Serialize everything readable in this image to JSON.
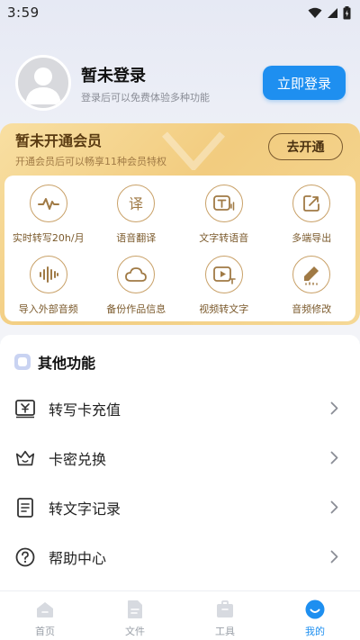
{
  "status_bar": {
    "time": "3:59"
  },
  "profile": {
    "name": "暂未登录",
    "subtitle": "登录后可以免费体验多种功能",
    "login_label": "立即登录"
  },
  "vip": {
    "title": "暂未开通会员",
    "subtitle": "开通会员后可以畅享11种会员特权",
    "open_label": "去开通",
    "features": [
      {
        "label": "实时转写20h/月",
        "icon": "waveform-icon"
      },
      {
        "label": "语音翻译",
        "icon": "translate-icon"
      },
      {
        "label": "文字转语音",
        "icon": "text-to-speech-icon"
      },
      {
        "label": "多端导出",
        "icon": "export-icon"
      },
      {
        "label": "导入外部音频",
        "icon": "audio-import-icon"
      },
      {
        "label": "备份作品信息",
        "icon": "cloud-backup-icon"
      },
      {
        "label": "视频转文字",
        "icon": "video-to-text-icon"
      },
      {
        "label": "音频修改",
        "icon": "audio-edit-icon"
      }
    ]
  },
  "other": {
    "title": "其他功能",
    "items": [
      {
        "label": "转写卡充值",
        "icon": "recharge-card-icon"
      },
      {
        "label": "卡密兑换",
        "icon": "crown-icon"
      },
      {
        "label": "转文字记录",
        "icon": "document-icon"
      },
      {
        "label": "帮助中心",
        "icon": "help-icon"
      }
    ]
  },
  "bottom_nav": {
    "items": [
      {
        "label": "首页",
        "icon": "home-icon",
        "active": false
      },
      {
        "label": "文件",
        "icon": "file-icon",
        "active": false
      },
      {
        "label": "工具",
        "icon": "toolbox-icon",
        "active": false
      },
      {
        "label": "我的",
        "icon": "profile-icon",
        "active": true
      }
    ]
  },
  "colors": {
    "accent": "#1e8ff0",
    "vip_gold": "#f2cc7f",
    "vip_text": "#5a3b12"
  }
}
